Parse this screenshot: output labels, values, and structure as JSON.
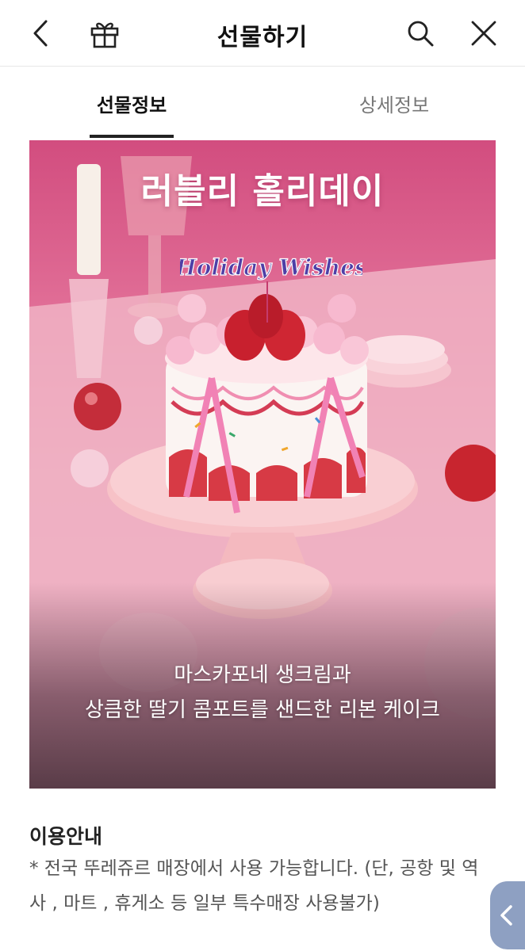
{
  "header": {
    "title": "선물하기",
    "back_icon": "chevron-left-icon",
    "gift_icon": "gift-icon",
    "search_icon": "search-icon",
    "close_icon": "close-icon"
  },
  "tabs": [
    {
      "label": "선물정보",
      "active": true
    },
    {
      "label": "상세정보",
      "active": false
    }
  ],
  "hero": {
    "headline": "러블리 홀리데이",
    "cake_topper": "Holiday Wishes",
    "description_line1": "마스카포네 생크림과",
    "description_line2": "상큼한 딸기 콤포트를 샌드한 리본 케이크"
  },
  "guide": {
    "title": "이용안내",
    "text": "* 전국 뚜레쥬르 매장에서 사용 가능합니다. (단, 공항 및 역사 , 마트 , 휴게소 등 일부 특수매장 사용불가)"
  },
  "side_button": {
    "icon": "chevron-left-icon"
  },
  "colors": {
    "accent_pink": "#d24d7f",
    "tab_active": "#222222",
    "side_button": "#8ea0c2"
  }
}
